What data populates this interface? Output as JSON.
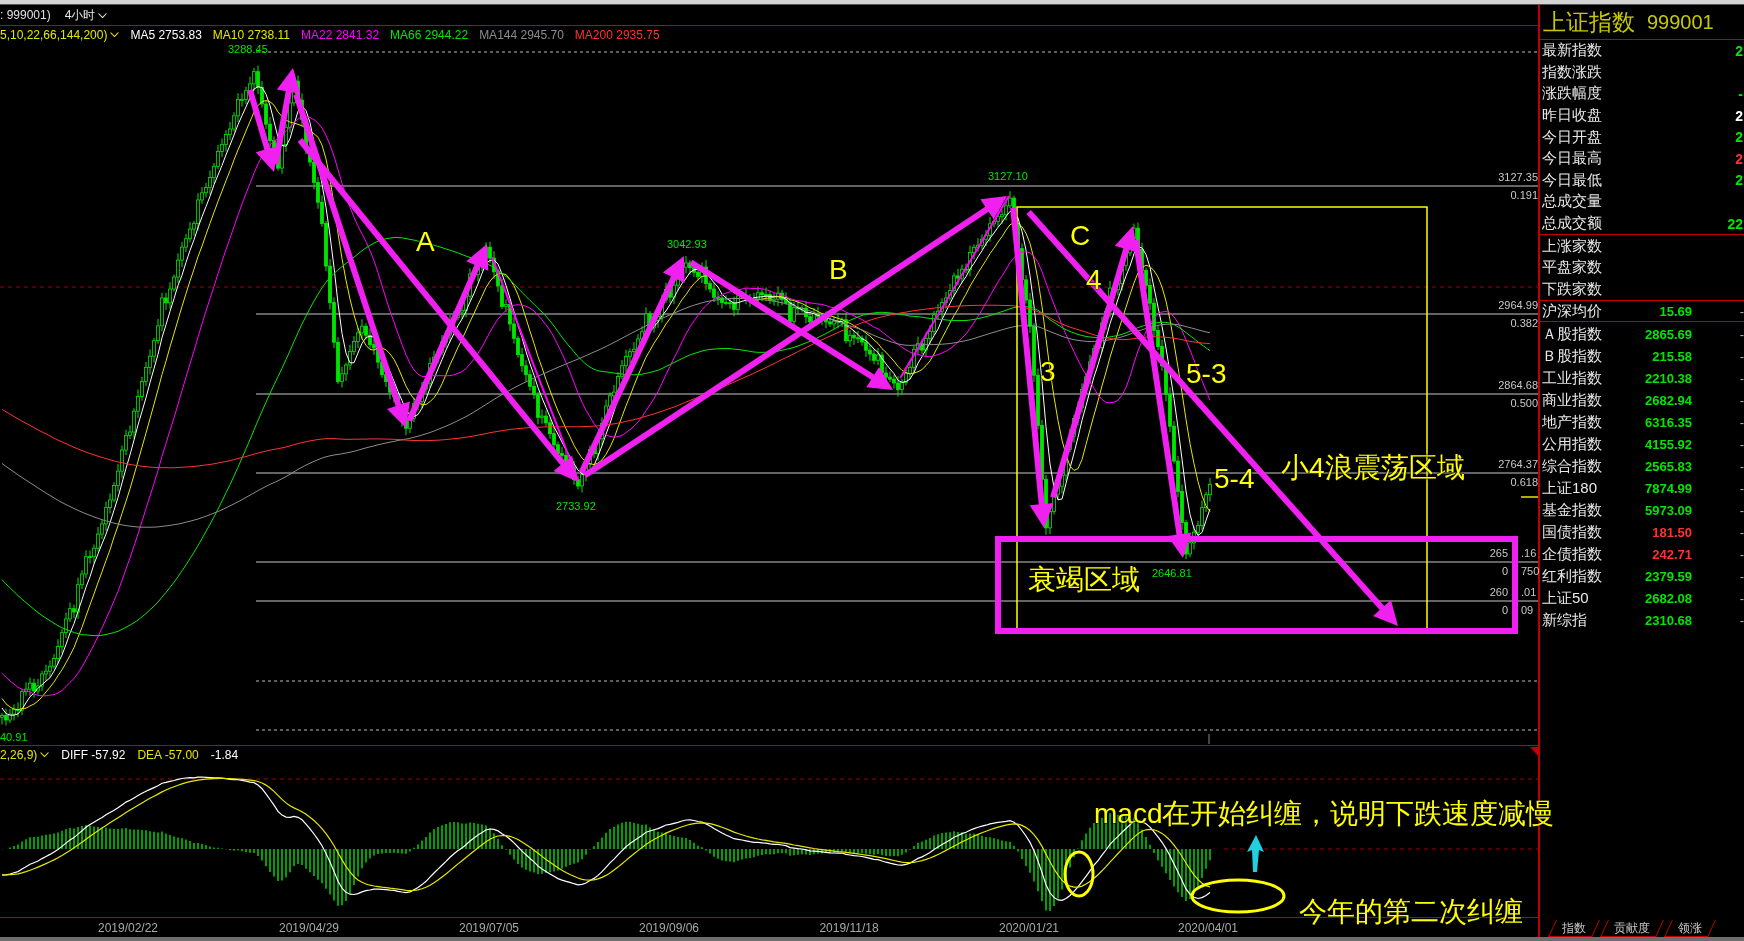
{
  "header": {
    "symbol": ": 999001)",
    "period": "4小时"
  },
  "ma_legend": {
    "params": "5,10,22,66,144,200)",
    "items": [
      {
        "label": "MA5 2753.83",
        "color": "#ffffff"
      },
      {
        "label": "MA10 2738.11",
        "color": "#e6e600"
      },
      {
        "label": "MA22 2841.32",
        "color": "#ff00ff"
      },
      {
        "label": "MA66 2944.22",
        "color": "#00e600"
      },
      {
        "label": "MA144 2945.70",
        "color": "#8c8c8c"
      },
      {
        "label": "MA200 2935.75",
        "color": "#ff3232"
      }
    ]
  },
  "price_chart": {
    "price_labels": [
      "3288.45",
      "2733.92",
      "3042.93",
      "3127.10",
      "2646.81",
      "40.91"
    ],
    "levels": [
      {
        "price": [
          "3127.35"
        ],
        "ratio": [
          "0.191"
        ]
      },
      {
        "price": [
          "2964.99"
        ],
        "ratio": [
          "0.382"
        ]
      },
      {
        "price": [
          "2864.68"
        ],
        "ratio": [
          "0.500"
        ]
      },
      {
        "price": [
          "2764.37"
        ],
        "ratio": [
          "0.618"
        ]
      },
      {
        "price": [
          "265",
          ".16"
        ],
        "ratio": [
          "0",
          "750"
        ]
      },
      {
        "price": [
          "260",
          ".01"
        ],
        "ratio": [
          "0",
          "09"
        ]
      }
    ],
    "annotations": [
      "A",
      "B",
      "C",
      "3",
      "4",
      "5-3",
      "5-4",
      "小4浪震荡区域",
      "衰竭区域"
    ]
  },
  "macd": {
    "params": "2,26,9)",
    "items": [
      {
        "label": "DIFF -57.92",
        "color": "#ffffff"
      },
      {
        "label": "DEA -57.00",
        "color": "#e6e600"
      },
      {
        "label": "-1.84",
        "color": "#ffffff"
      }
    ],
    "notes": [
      "macd在开始纠缠，说明下跌速度减慢",
      "今年的第二次纠缠"
    ]
  },
  "date_axis": [
    "2019/02/22",
    "2019/04/29",
    "2019/07/05",
    "2019/09/06",
    "2019/11/18",
    "2020/01/21",
    "2020/04/01"
  ],
  "quote_panel": {
    "title": "上证指数",
    "code": "999001",
    "stats": [
      {
        "label": "最新指数",
        "value": "2",
        "color": "#00e600"
      },
      {
        "label": "指数涨跌"
      },
      {
        "label": "涨跌幅度",
        "value": "-",
        "color": "#00e600"
      },
      {
        "label": "昨日收盘",
        "value": "2",
        "color": "#ffffff"
      },
      {
        "label": "今日开盘",
        "value": "2",
        "color": "#00e600"
      },
      {
        "label": "今日最高",
        "value": "2",
        "color": "#ff3232"
      },
      {
        "label": "今日最低",
        "value": "2",
        "color": "#00e600"
      },
      {
        "label": "总成交量"
      },
      {
        "label": "总成交额",
        "value": "22",
        "color": "#00e600"
      }
    ],
    "market": [
      "上涨家数",
      "平盘家数",
      "下跌家数"
    ],
    "average": {
      "label": "沪深均价",
      "value": "15.69",
      "change": "-"
    },
    "indices": [
      {
        "label": "Ａ股指数",
        "value": "2865.69",
        "color": "#00e600",
        "change": "-"
      },
      {
        "label": "Ｂ股指数",
        "value": "215.58",
        "color": "#00e600",
        "change": "-"
      },
      {
        "label": "工业指数",
        "value": "2210.38",
        "color": "#00e600",
        "change": "-"
      },
      {
        "label": "商业指数",
        "value": "2682.94",
        "color": "#00e600",
        "change": "-"
      },
      {
        "label": "地产指数",
        "value": "6316.35",
        "color": "#00e600",
        "change": "-"
      },
      {
        "label": "公用指数",
        "value": "4155.92",
        "color": "#00e600",
        "change": "-"
      },
      {
        "label": "综合指数",
        "value": "2565.83",
        "color": "#00e600",
        "change": "-"
      },
      {
        "label": "上证180",
        "value": "7874.99",
        "color": "#00e600",
        "change": "-"
      },
      {
        "label": "基金指数",
        "value": "5973.09",
        "color": "#00e600",
        "change": "-"
      },
      {
        "label": "国债指数",
        "value": "181.50",
        "color": "#ff3232",
        "change": "-"
      },
      {
        "label": "企债指数",
        "value": "242.71",
        "color": "#ff3232",
        "change": "-"
      },
      {
        "label": "红利指数",
        "value": "2379.59",
        "color": "#00e600",
        "change": "-"
      },
      {
        "label": "上证50",
        "value": "2682.08",
        "color": "#00e600",
        "change": "-"
      },
      {
        "label": "新综指",
        "value": "2310.68",
        "color": "#00e600",
        "change": "-"
      }
    ],
    "tabs": [
      "指数",
      "贡献度",
      "领涨"
    ]
  }
}
